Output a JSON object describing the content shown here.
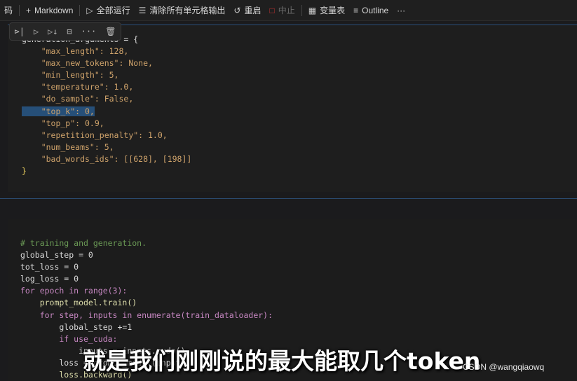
{
  "toolbar": {
    "cut_label": "码",
    "markdown_label": "Markdown",
    "run_all_label": "全部运行",
    "clear_outputs_label": "清除所有单元格输出",
    "restart_label": "重启",
    "interrupt_label": "中止",
    "variables_label": "变量表",
    "outline_label": "Outline",
    "more_label": "···"
  },
  "cell_toolbar": {
    "more_label": "···"
  },
  "cell1": {
    "lines": [
      "generation_arguments = {",
      "    \"max_length\": 128,",
      "    \"max_new_tokens\": None,",
      "    \"min_length\": 5,",
      "    \"temperature\": 1.0,",
      "    \"do_sample\": False,",
      "    \"top_k\": 0,",
      "    \"top_p\": 0.9,",
      "    \"repetition_penalty\": 1.0,",
      "    \"num_beams\": 5,",
      "    \"bad_words_ids\": [[628], [198]]",
      "}"
    ]
  },
  "cell2": {
    "lines": [
      "# training and generation.",
      "global_step = 0",
      "tot_loss = 0",
      "log_loss = 0",
      "for epoch in range(3):",
      "    prompt_model.train()",
      "    for step, inputs in enumerate(train_dataloader):",
      "        global_step +=1",
      "        if use_cuda:",
      "            inputs = inputs.cuda()",
      "        loss = prompt_model(inputs)",
      "        loss.backward()"
    ]
  },
  "subtitle": "就是我们刚刚说的最大能取几个token",
  "watermark": "CSDN @wangqiaowq"
}
